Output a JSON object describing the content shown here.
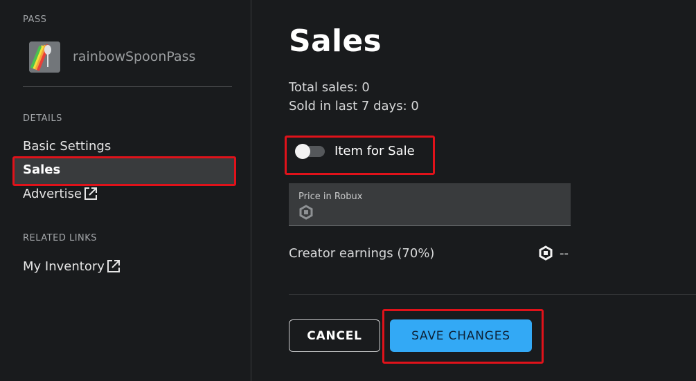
{
  "sidebar": {
    "pass_section_label": "PASS",
    "pass_name": "rainbowSpoonPass",
    "details_section_label": "DETAILS",
    "items": [
      {
        "label": "Basic Settings"
      },
      {
        "label": "Sales"
      },
      {
        "label": "Advertise"
      }
    ],
    "related_section_label": "RELATED LINKS",
    "related_items": [
      {
        "label": "My Inventory"
      }
    ]
  },
  "main": {
    "title": "Sales",
    "total_sales": "Total sales: 0",
    "sold_last_7_days": "Sold in last 7 days: 0",
    "toggle_label": "Item for Sale",
    "toggle_on": false,
    "price_label": "Price in Robux",
    "earnings_label": "Creator earnings (70%)",
    "earnings_value": "--",
    "cancel_label": "CANCEL",
    "save_label": "SAVE CHANGES"
  },
  "colors": {
    "background": "#191b1d",
    "highlight": "#e0121a",
    "save_button": "#33a9f5"
  },
  "icons": [
    "external-link-icon",
    "robux-icon"
  ]
}
